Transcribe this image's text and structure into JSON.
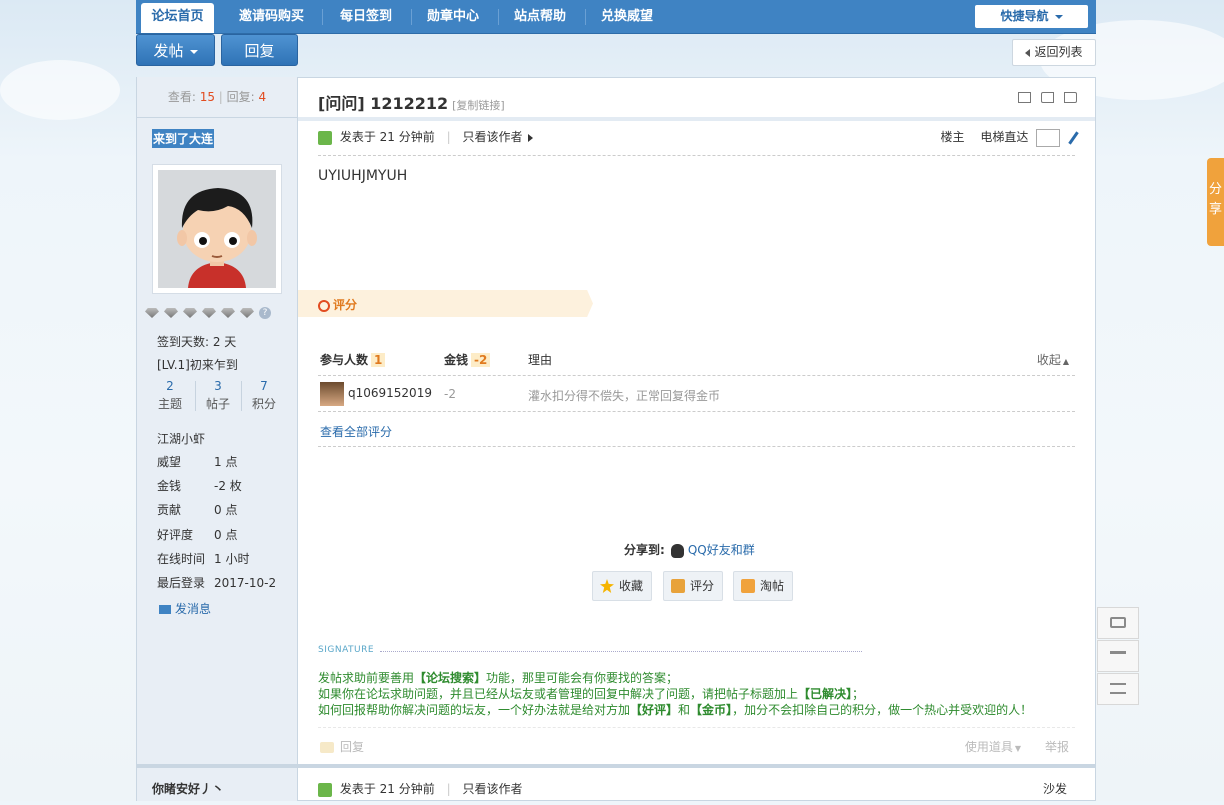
{
  "topnav": {
    "items": [
      "论坛首页",
      "邀请码购买",
      "每日签到",
      "勋章中心",
      "站点帮助",
      "兑换威望"
    ],
    "quick_nav": "快捷导航"
  },
  "actions": {
    "new_post": "发帖",
    "reply": "回复",
    "back_to_list": "返回列表"
  },
  "thread": {
    "views_label": "查看:",
    "views": "15",
    "replies_label": "回复:",
    "replies": "4",
    "title": "[问问] 1212212",
    "copy_link": "[复制链接]"
  },
  "author": {
    "name": "来到了大连",
    "checkin": "签到天数: 2 天",
    "level": "[LV.1]初来乍到",
    "counts": [
      {
        "value": "2",
        "label": "主题"
      },
      {
        "value": "3",
        "label": "帖子"
      },
      {
        "value": "7",
        "label": "积分"
      }
    ],
    "rank": "江湖小虾",
    "profile": [
      {
        "key": "威望",
        "value": "1 点"
      },
      {
        "key": "金钱",
        "value": "-2 枚"
      },
      {
        "key": "贡献",
        "value": "0 点"
      },
      {
        "key": "好评度",
        "value": "0 点"
      },
      {
        "key": "在线时间",
        "value": "1 小时"
      },
      {
        "key": "最后登录",
        "value": "2017-10-2"
      }
    ],
    "send_message": "发消息"
  },
  "post": {
    "posted": "发表于 21 分钟前",
    "only_author": "只看该作者",
    "floor": "楼主",
    "elevator": "电梯直达",
    "body": "UYIUHJMYUH"
  },
  "rating": {
    "banner": "评分",
    "col_participants": "参与人数",
    "participants": "1",
    "col_money": "金钱",
    "money": "-2",
    "col_reason": "理由",
    "collapse": "收起",
    "rows": [
      {
        "user": "q1069152019",
        "money": "-2",
        "reason": "灌水扣分得不偿失，正常回复得金币"
      }
    ],
    "view_all": "查看全部评分"
  },
  "share": {
    "label": "分享到:",
    "qq": "QQ好友和群",
    "buttons": [
      "收藏",
      "评分",
      "淘帖"
    ]
  },
  "signature": {
    "title": "SIGNATURE",
    "line1_a": "发帖求助前要善用",
    "line1_b": "【论坛搜索】",
    "line1_c": "功能，那里可能会有你要找的答案；",
    "line2_a": "如果你在论坛求助问题，并且已经从坛友或者管理的回复中解决了问题，请把帖子标题加上",
    "line2_b": "【已解决】",
    "line2_c": "；",
    "line3_a": "如何回报帮助你解决问题的坛友，一个好办法就是给对方加",
    "line3_b": "【好评】",
    "line3_c": "和",
    "line3_d": "【金币】",
    "line3_e": "，加分不会扣除自己的积分，做一个热心并受欢迎的人！"
  },
  "post_footer": {
    "reply": "回复",
    "use_tool": "使用道具",
    "report": "举报"
  },
  "next_post": {
    "author": "你睹安好丿丶",
    "posted": "发表于 21 分钟前",
    "only_author": "只看该作者",
    "floor": "沙发"
  },
  "side_share": "分享",
  "colors": {
    "nav_blue": "#3f83c3",
    "link_blue": "#2a6bab",
    "accent_red": "#e24c20",
    "signature_green": "#2e8b2e"
  }
}
